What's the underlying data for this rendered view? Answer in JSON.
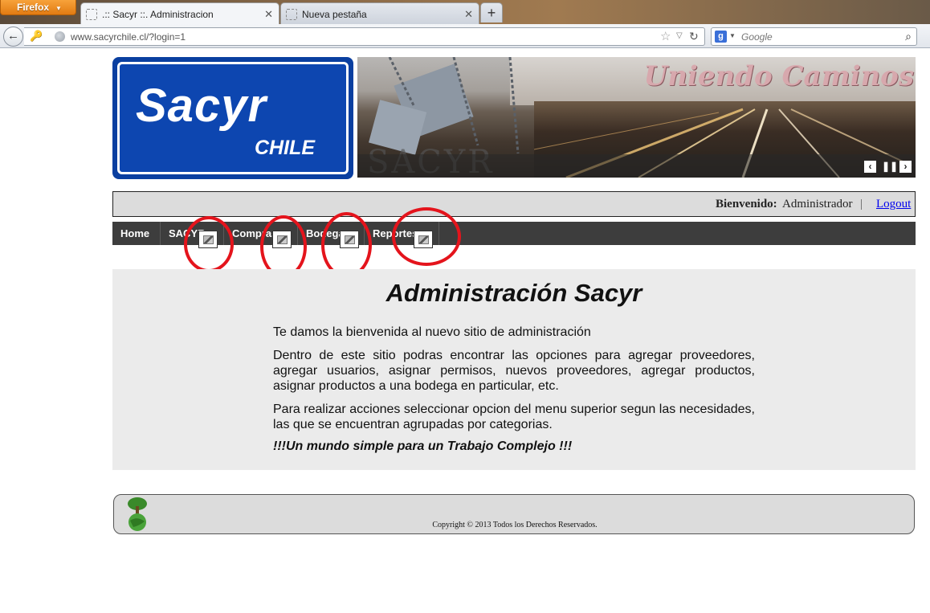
{
  "browser": {
    "app_button": "Firefox",
    "tabs": [
      {
        "title": ".:: Sacyr ::. Administracion",
        "active": true
      },
      {
        "title": "Nueva pestaña",
        "active": false
      }
    ],
    "url": "www.sacyrchile.cl/?login=1",
    "search_placeholder": "Google",
    "search_engine_icon": "google-icon"
  },
  "header": {
    "logo_word": "Sacyr",
    "logo_sub": "CHILE",
    "banner_slogan": "Uniendo Caminos",
    "banner_watermark": "SACYR",
    "banner_controls": [
      "‹",
      "❚❚",
      "›"
    ]
  },
  "welcome": {
    "label": "Bienvenido:",
    "user": "Administrador",
    "separator": "|",
    "logout": "Logout"
  },
  "menu": {
    "items": [
      "Home",
      "SACYR",
      "Compras",
      "Bodega",
      "Reportes"
    ]
  },
  "content": {
    "title": "Administración Sacyr",
    "paragraphs": [
      "Te damos la bienvenida al nuevo sitio de administración",
      "Dentro de este sitio podras encontrar las opciones para agregar proveedores, agregar usuarios, asignar permisos, nuevos proveedores, agregar productos, asignar productos a una bodega en particular, etc.",
      "Para realizar acciones seleccionar opcion del menu superior segun las necesidades, las que se encuentran agrupadas por categorias."
    ],
    "slogan": "!!!Un mundo simple para un Trabajo Complejo !!!"
  },
  "footer": {
    "copyright": "Copyright © 2013 Todos los Derechos Reservados."
  },
  "colors": {
    "brand_blue": "#0a3fa0",
    "menu_bg": "#3d3d3d",
    "annotation_red": "#e4141c",
    "firefox_orange": "#e27b12"
  }
}
